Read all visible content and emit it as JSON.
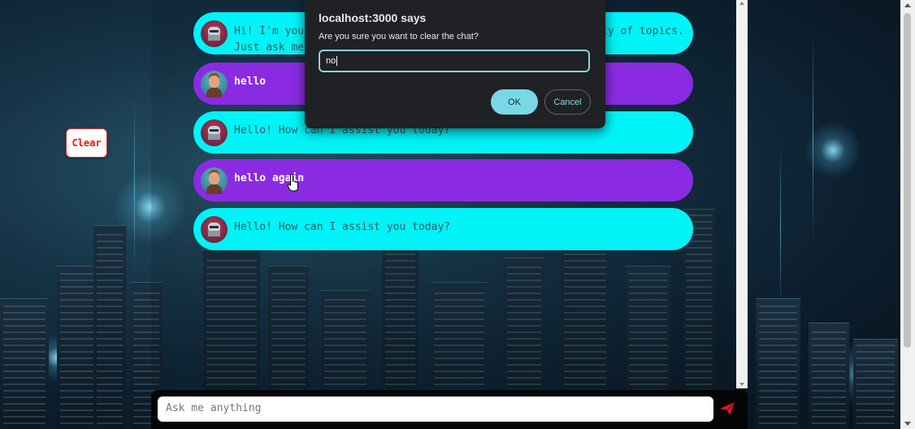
{
  "dialog": {
    "title": "localhost:3000 says",
    "message": "Are you sure you want to clear the chat?",
    "input_value": "no",
    "ok_label": "OK",
    "cancel_label": "Cancel"
  },
  "sidebar": {
    "clear_label": "Clear"
  },
  "messages": [
    {
      "role": "bot",
      "line1": "Hi! I'm your",
      "line1_tail": "ty of topics.",
      "line2": "Just ask me"
    },
    {
      "role": "user",
      "text": "hello"
    },
    {
      "role": "bot",
      "text": "Hello! How can I assist you today?"
    },
    {
      "role": "user",
      "text": "hello again"
    },
    {
      "role": "bot",
      "text": "Hello! How can I assist you today?"
    }
  ],
  "composer": {
    "placeholder": "Ask me anything"
  },
  "colors": {
    "bot_bubble": "#00f3f7",
    "user_bubble": "#8a2be2",
    "ok_button": "#78d8e6",
    "send_icon": "#e0162b"
  },
  "icons": [
    "robot-avatar-icon",
    "user-avatar-icon",
    "send-icon",
    "hand-cursor-icon"
  ]
}
